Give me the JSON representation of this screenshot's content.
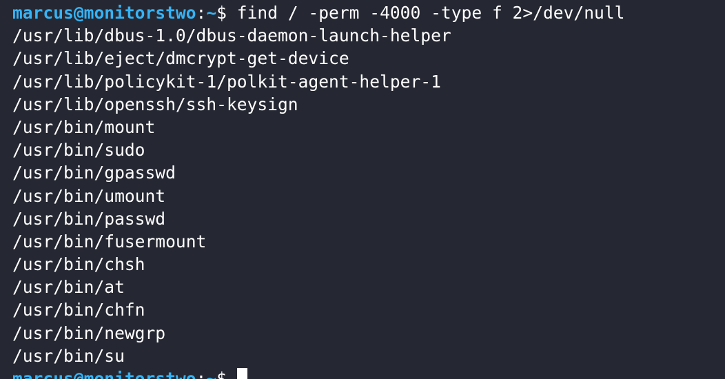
{
  "prompt": {
    "user_host": "marcus@monitorstwo",
    "separator": ":",
    "path": "~",
    "symbol": "$"
  },
  "command": " find / -perm -4000 -type f 2>/dev/null",
  "output": [
    "/usr/lib/dbus-1.0/dbus-daemon-launch-helper",
    "/usr/lib/eject/dmcrypt-get-device",
    "/usr/lib/policykit-1/polkit-agent-helper-1",
    "/usr/lib/openssh/ssh-keysign",
    "/usr/bin/mount",
    "/usr/bin/sudo",
    "/usr/bin/gpasswd",
    "/usr/bin/umount",
    "/usr/bin/passwd",
    "/usr/bin/fusermount",
    "/usr/bin/chsh",
    "/usr/bin/at",
    "/usr/bin/chfn",
    "/usr/bin/newgrp",
    "/usr/bin/su"
  ],
  "colors": {
    "background": "#252832",
    "prompt": "#36b3f5",
    "text": "#ffffff"
  }
}
